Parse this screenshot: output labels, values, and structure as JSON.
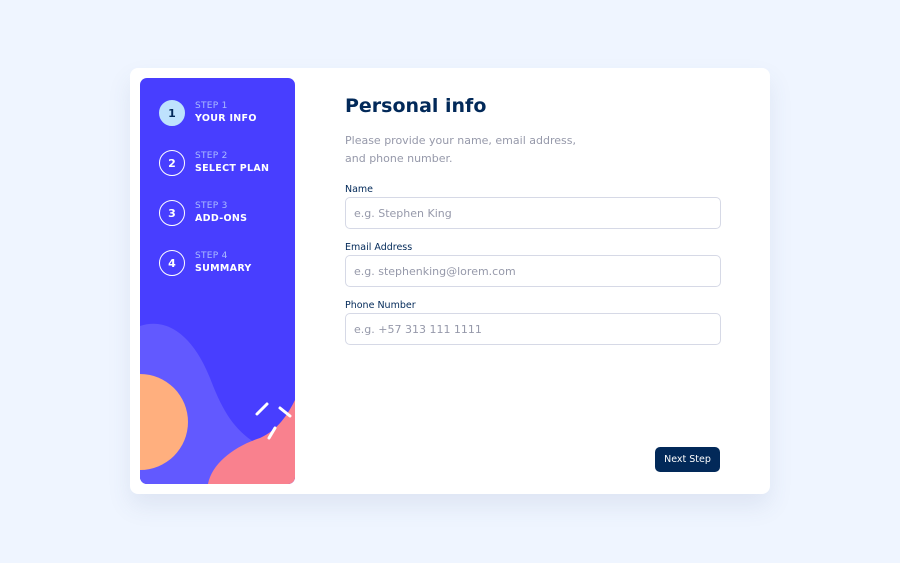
{
  "steps": [
    {
      "number": "1",
      "label": "STEP 1",
      "title": "YOUR INFO",
      "active": true
    },
    {
      "number": "2",
      "label": "STEP 2",
      "title": "SELECT PLAN",
      "active": false
    },
    {
      "number": "3",
      "label": "STEP 3",
      "title": "ADD-ONS",
      "active": false
    },
    {
      "number": "4",
      "label": "STEP 4",
      "title": "SUMMARY",
      "active": false
    }
  ],
  "form": {
    "title": "Personal info",
    "subtitle": "Please provide your name, email address, and phone number.",
    "fields": [
      {
        "label": "Name",
        "value": "",
        "placeholder": "e.g. Stephen King"
      },
      {
        "label": "Email Address",
        "value": "",
        "placeholder": "e.g. stephenking@lorem.com"
      },
      {
        "label": "Phone Number",
        "value": "",
        "placeholder": "e.g. +57 313 111 1111"
      }
    ],
    "next_label": "Next Step"
  },
  "colors": {
    "page_background": "#eff5ff",
    "sidebar_background": "#483eff",
    "active_step": "#bee2fd",
    "primary_text": "#022959",
    "muted_text": "#9699aa",
    "accent_orange": "#ffaf7e",
    "accent_pink": "#f9818e",
    "accent_purple": "#6259ff"
  }
}
